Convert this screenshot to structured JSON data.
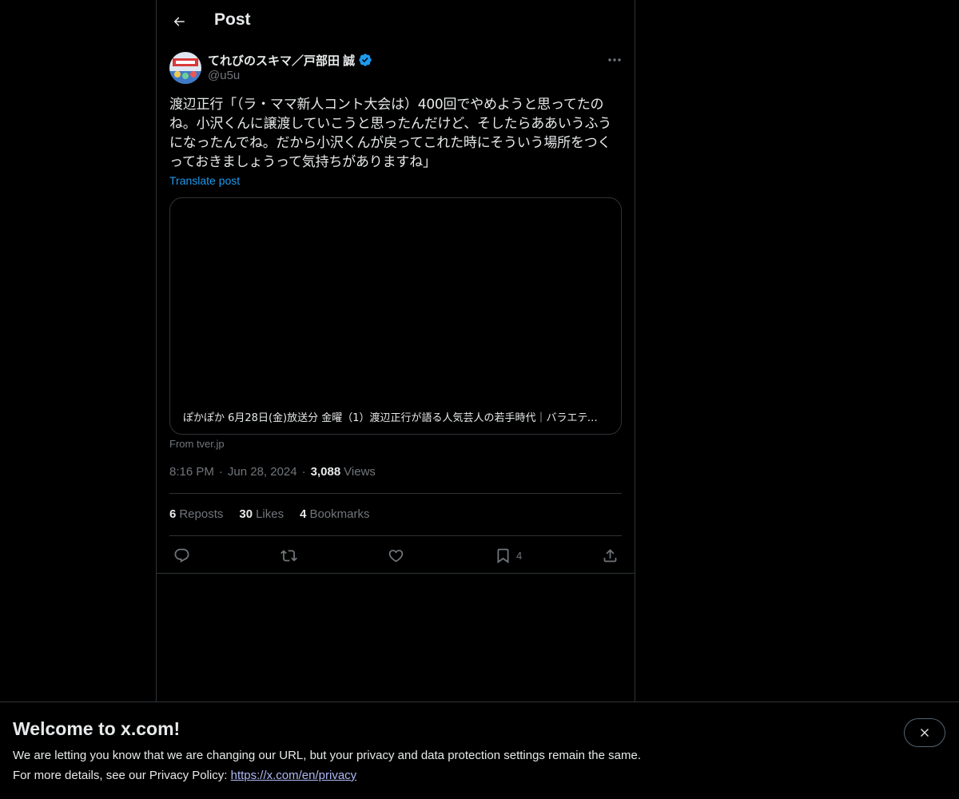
{
  "header": {
    "title": "Post"
  },
  "author": {
    "name": "てれびのスキマ／戸部田 誠",
    "handle": "@u5u",
    "verified": true
  },
  "post": {
    "text": "渡辺正行「（ラ・ママ新人コント大会は）400回でやめようと思ってたのね。小沢くんに譲渡していこうと思ったんだけど、そしたらああいうふうになったんでね。だから小沢くんが戻ってこれた時にそういう場所をつくっておきましょうって気持ちがありますね」",
    "translate_label": "Translate post"
  },
  "card": {
    "caption": "ぽかぽか 6月28日(金)放送分 金曜（1）渡辺正行が語る人気芸人の若手時代｜バラエティ…",
    "source": "From tver.jp"
  },
  "meta": {
    "time": "8:16 PM",
    "date": "Jun 28, 2024",
    "views_count": "3,088",
    "views_label": "Views"
  },
  "stats": {
    "reposts_count": "6",
    "reposts_label": "Reposts",
    "likes_count": "30",
    "likes_label": "Likes",
    "bookmarks_count": "4",
    "bookmarks_label": "Bookmarks"
  },
  "actions": {
    "bookmark_count": "4"
  },
  "banner": {
    "title": "Welcome to x.com!",
    "line1": "We are letting you know that we are changing our URL, but your privacy and data protection settings remain the same.",
    "line2_prefix": "For more details, see our Privacy Policy:",
    "link": "https://x.com/en/privacy"
  },
  "icons": {
    "back": "arrow-left-icon",
    "verified": "verified-badge-icon",
    "more": "more-dots-icon",
    "reply": "reply-icon",
    "repost": "repost-icon",
    "like": "heart-icon",
    "bookmark": "bookmark-icon",
    "share": "share-icon",
    "close": "close-icon"
  },
  "colors": {
    "background": "#000000",
    "text": "#e7e9ea",
    "muted": "#71767b",
    "accent": "#1d9bf0",
    "border": "#2f3336",
    "link": "#aeb9f5"
  }
}
